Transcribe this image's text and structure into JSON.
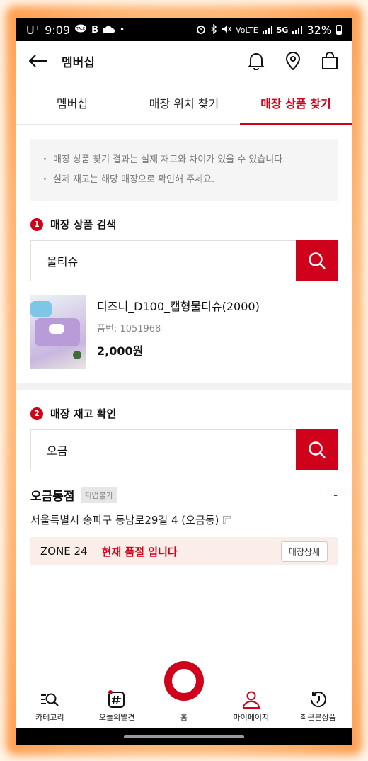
{
  "status": {
    "carrier": "U⁺",
    "time": "9:09",
    "talk_icon": "talk-badge-icon",
    "b_icon": "B",
    "cloud_icon": "cloud-icon",
    "dot": "•",
    "right_icons": [
      "alarm-icon",
      "bluetooth-icon",
      "mute-icon"
    ],
    "volte": "VoLTE",
    "network": "5G",
    "battery": "32%"
  },
  "appbar": {
    "title": "멤버십"
  },
  "tabs": [
    {
      "label": "멤버십"
    },
    {
      "label": "매장 위치 찾기"
    },
    {
      "label": "매장 상품 찾기"
    }
  ],
  "notice": [
    "매장 상품 찾기 결과는 실제 재고와 차이가 있을 수 있습니다.",
    "실제 재고는 해당 매장으로 확인해 주세요."
  ],
  "product_search": {
    "step": "1",
    "title": "매장 상품 검색",
    "query": "물티슈"
  },
  "product": {
    "name": "디즈니_D100_캡형물티슈(2000)",
    "code": "품번: 1051968",
    "price": "2,000원"
  },
  "stock": {
    "step": "2",
    "title": "매장 재고 확인",
    "query": "오금"
  },
  "store": {
    "name": "오금동점",
    "badge": "픽업불가",
    "toggle": "-",
    "address": "서울특별시 송파구 동남로29길 4 (오금동)",
    "zone": "ZONE 24",
    "status": "현재 품절 입니다",
    "detail_button": "매장상세"
  },
  "nav": [
    {
      "label": "카테고리",
      "icon": "category-search-icon"
    },
    {
      "label": "오늘의발견",
      "icon": "hashtag-icon"
    },
    {
      "label": "홈",
      "icon": "home-ring-icon"
    },
    {
      "label": "마이페이지",
      "icon": "person-icon"
    },
    {
      "label": "최근본상품",
      "icon": "history-icon"
    }
  ],
  "colors": {
    "accent": "#d0021b"
  }
}
